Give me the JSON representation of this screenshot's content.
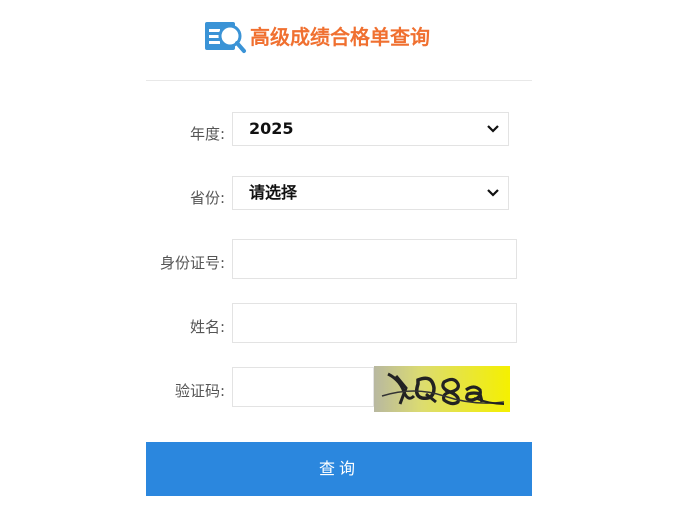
{
  "header": {
    "title": "高级成绩合格单查询",
    "logo_icon": "search-document-icon",
    "title_color": "#f07030"
  },
  "form": {
    "year": {
      "label": "年度:",
      "value": "2025"
    },
    "province": {
      "label": "省份:",
      "value": "请选择"
    },
    "id_number": {
      "label": "身份证号:",
      "value": ""
    },
    "name": {
      "label": "姓名:",
      "value": ""
    },
    "captcha": {
      "label": "验证码:",
      "value": "",
      "image_text": "YQ8a"
    }
  },
  "submit_label": "查询",
  "colors": {
    "button": "#2b87de",
    "captcha_bg": "#f5f000"
  }
}
